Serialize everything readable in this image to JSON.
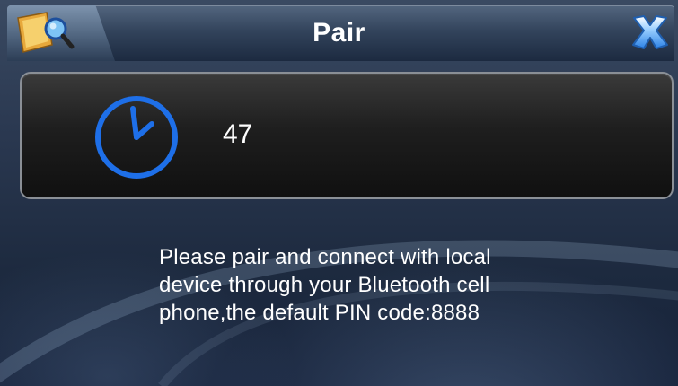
{
  "header": {
    "title": "Pair",
    "app_icon": "bluetooth-search-icon",
    "close_icon": "close-icon"
  },
  "timer": {
    "icon": "clock-icon",
    "seconds_remaining": "47"
  },
  "message": {
    "line1": "Please pair and connect with local",
    "line2": "device through your Bluetooth cell",
    "line3": "phone,the default PIN code:8888"
  },
  "colors": {
    "accent_blue": "#1e6fe8",
    "close_blue": "#5aa8ff"
  }
}
